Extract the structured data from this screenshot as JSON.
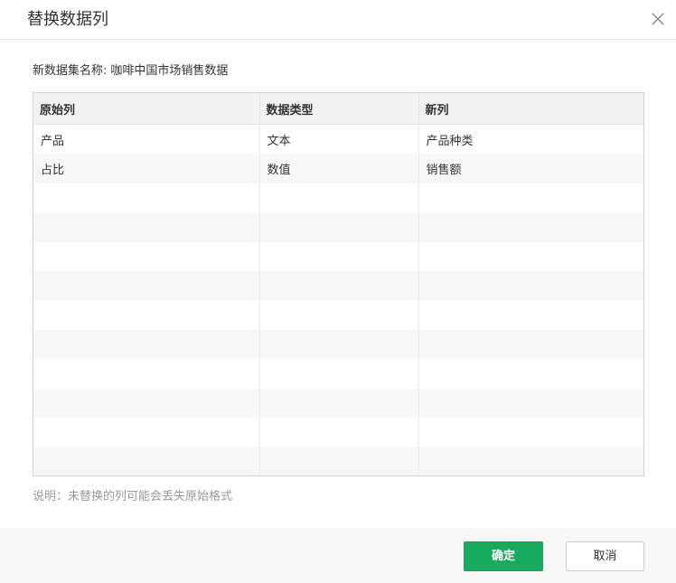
{
  "dialog": {
    "title": "替换数据列",
    "close_icon": "close-icon"
  },
  "dataset": {
    "label": "新数据集名称:",
    "value": "咖啡中国市场销售数据"
  },
  "table": {
    "headers": [
      "原始列",
      "数据类型",
      "新列"
    ],
    "rows": [
      [
        "产品",
        "文本",
        "产品种类"
      ],
      [
        "占比",
        "数值",
        "销售额"
      ],
      [
        "",
        "",
        ""
      ],
      [
        "",
        "",
        ""
      ],
      [
        "",
        "",
        ""
      ],
      [
        "",
        "",
        ""
      ],
      [
        "",
        "",
        ""
      ],
      [
        "",
        "",
        ""
      ],
      [
        "",
        "",
        ""
      ],
      [
        "",
        "",
        ""
      ],
      [
        "",
        "",
        ""
      ],
      [
        "",
        "",
        ""
      ]
    ]
  },
  "note": "说明：未替换的列可能会丢失原始格式",
  "footer": {
    "ok_label": "确定",
    "cancel_label": "取消"
  },
  "colors": {
    "accent": "#1aaa5f",
    "header_bg": "#f2f2f2",
    "note": "#999999"
  }
}
